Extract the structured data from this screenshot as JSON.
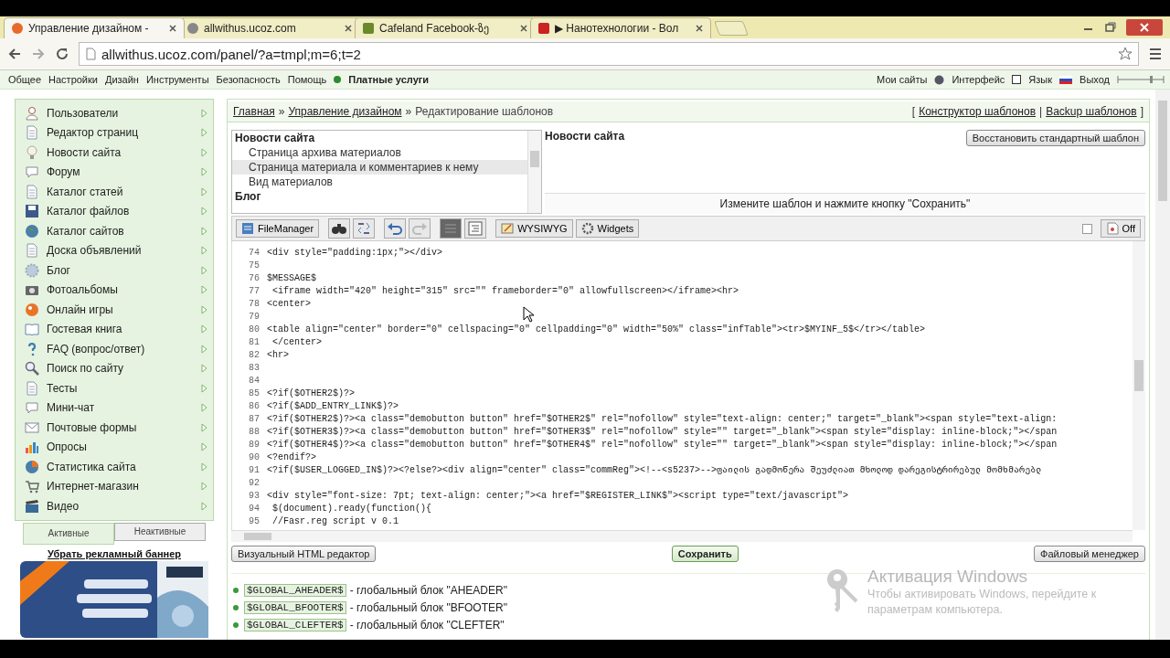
{
  "browser": {
    "tabs": [
      {
        "title": "Управление дизайном -",
        "selected": true
      },
      {
        "title": "allwithus.ucoz.com",
        "selected": false
      },
      {
        "title": "Cafeland Facebook-ზე",
        "selected": false
      },
      {
        "title": "▶ Нанотехнологии - Вол",
        "selected": false
      }
    ],
    "address": "allwithus.ucoz.com/panel/?a=tmpl;m=6;t=2"
  },
  "top_menu": {
    "left": [
      "Общее",
      "Настройки",
      "Дизайн",
      "Инструменты",
      "Безопасность",
      "Помощь"
    ],
    "paid": "Платные услуги",
    "right": [
      "Мои сайты",
      "Интерфейс",
      "Язык",
      "Выход"
    ]
  },
  "sidebar": {
    "items": [
      "Пользователи",
      "Редактор страниц",
      "Новости сайта",
      "Форум",
      "Каталог статей",
      "Каталог файлов",
      "Каталог сайтов",
      "Доска объявлений",
      "Блог",
      "Фотоальбомы",
      "Онлайн игры",
      "Гостевая книга",
      "FAQ (вопрос/ответ)",
      "Поиск по сайту",
      "Тесты",
      "Мини-чат",
      "Почтовые формы",
      "Опросы",
      "Статистика сайта",
      "Интернет-магазин",
      "Видео"
    ],
    "tabs": [
      {
        "label": "Активные",
        "selected": true
      },
      {
        "label": "Неактивные",
        "selected": false
      }
    ],
    "remove_banner": "Убрать рекламный баннер",
    "banner": {
      "kind": "picture"
    }
  },
  "breadcrumb": [
    "Главная",
    "Управление дизайном",
    "Редактирование шаблонов"
  ],
  "breadcrumb_separator": "»",
  "breadcrumb_links": [
    "Конструктор шаблонов",
    "Backup шаблонов"
  ],
  "breadcrumb_links_marks": {
    "open": "[",
    "divider": "|",
    "close": "]"
  },
  "template_list": [
    {
      "title": "Новости сайта",
      "items": [
        {
          "label": "Страница архива материалов",
          "selected": false
        },
        {
          "label": "Страница материала и комментариев к нему",
          "selected": true
        },
        {
          "label": "Вид материалов",
          "selected": false
        }
      ]
    },
    {
      "title": "Блог"
    }
  ],
  "template_title": "Новости сайта",
  "restore_button": "Восстановить стандартный шаблон",
  "hint": "Измените шаблон и нажмите кнопку \"Сохранить\"",
  "toolbar": {
    "file_manager": "FileManager",
    "wysiwyg": "WYSIWYG",
    "widgets": "Widgets",
    "off": "Off",
    "wrap_checked": false
  },
  "code": [
    {
      "n": "74",
      "t": "<div style=\"padding:1px;\"></div>"
    },
    {
      "n": "75"
    },
    {
      "n": "76",
      "t": "$MESSAGE$"
    },
    {
      "n": "77",
      "t": " <iframe width=\"420\" height=\"315\" src=\"\" frameborder=\"0\" allowfullscreen></iframe><hr>"
    },
    {
      "n": "78",
      "t": "<center>"
    },
    {
      "n": "79"
    },
    {
      "n": "80",
      "t": "<table align=\"center\" border=\"0\" cellspacing=\"0\" cellpadding=\"0\" width=\"50%\" class=\"infTable\"><tr>$MYINF_5$</tr></table>"
    },
    {
      "n": "81",
      "t": " </center>"
    },
    {
      "n": "82",
      "t": "<hr>"
    },
    {
      "n": "83"
    },
    {
      "n": "84"
    },
    {
      "n": "85",
      "t": "<?if($OTHER2$)?>"
    },
    {
      "n": "86",
      "t": "<?if($ADD_ENTRY_LINK$)?>"
    },
    {
      "n": "87",
      "t": "<?if($OTHER2$)?><a class=\"demobutton button\" href=\"$OTHER2$\" rel=\"nofollow\" style=\"text-align: center;\" target=\"_blank\"><span style=\"text-align:"
    },
    {
      "n": "88",
      "t": "<?if($OTHER3$)?><a class=\"demobutton button\" href=\"$OTHER3$\" rel=\"nofollow\" style=\"\" target=\"_blank\"><span style=\"display: inline-block;\"></span"
    },
    {
      "n": "89",
      "t": "<?if($OTHER4$)?><a class=\"demobutton button\" href=\"$OTHER4$\" rel=\"nofollow\" style=\"\" target=\"_blank\"><span style=\"display: inline-block;\"></span"
    },
    {
      "n": "90",
      "t": "<?endif?>"
    },
    {
      "n": "91",
      "t": "<?if($USER_LOGGED_IN$)?><?else?><div align=\"center\" class=\"commReg\"><!--<s5237>-->ფაილის გადმოწერა შეუძლიათ მხოლოდ დარეგისტრირებულ მომხმარებლ"
    },
    {
      "n": "92"
    },
    {
      "n": "93",
      "t": "<div style=\"font-size: 7pt; text-align: center;\"><a href=\"$REGISTER_LINK$\"><script type=\"text/javascript\">"
    },
    {
      "n": "94",
      "t": " $(document).ready(function(){"
    },
    {
      "n": "95",
      "t": " //Fasr.reg script v 0.1"
    }
  ],
  "buttons": {
    "visual_editor": "Визуальный HTML редактор",
    "save": "Сохранить",
    "file_manager": "Файловый менеджер"
  },
  "globals": [
    {
      "code": "$GLOBAL_AHEADER$",
      "desc": "- глобальный блок \"AHEADER\""
    },
    {
      "code": "$GLOBAL_BFOOTER$",
      "desc": "- глобальный блок \"BFOOTER\""
    },
    {
      "code": "$GLOBAL_CLEFTER$",
      "desc": "- глобальный блок \"CLEFTER\""
    }
  ],
  "windows_notice": {
    "title": "Активация Windows",
    "text": "Чтобы активировать Windows, перейдите к параметрам компьютера."
  }
}
